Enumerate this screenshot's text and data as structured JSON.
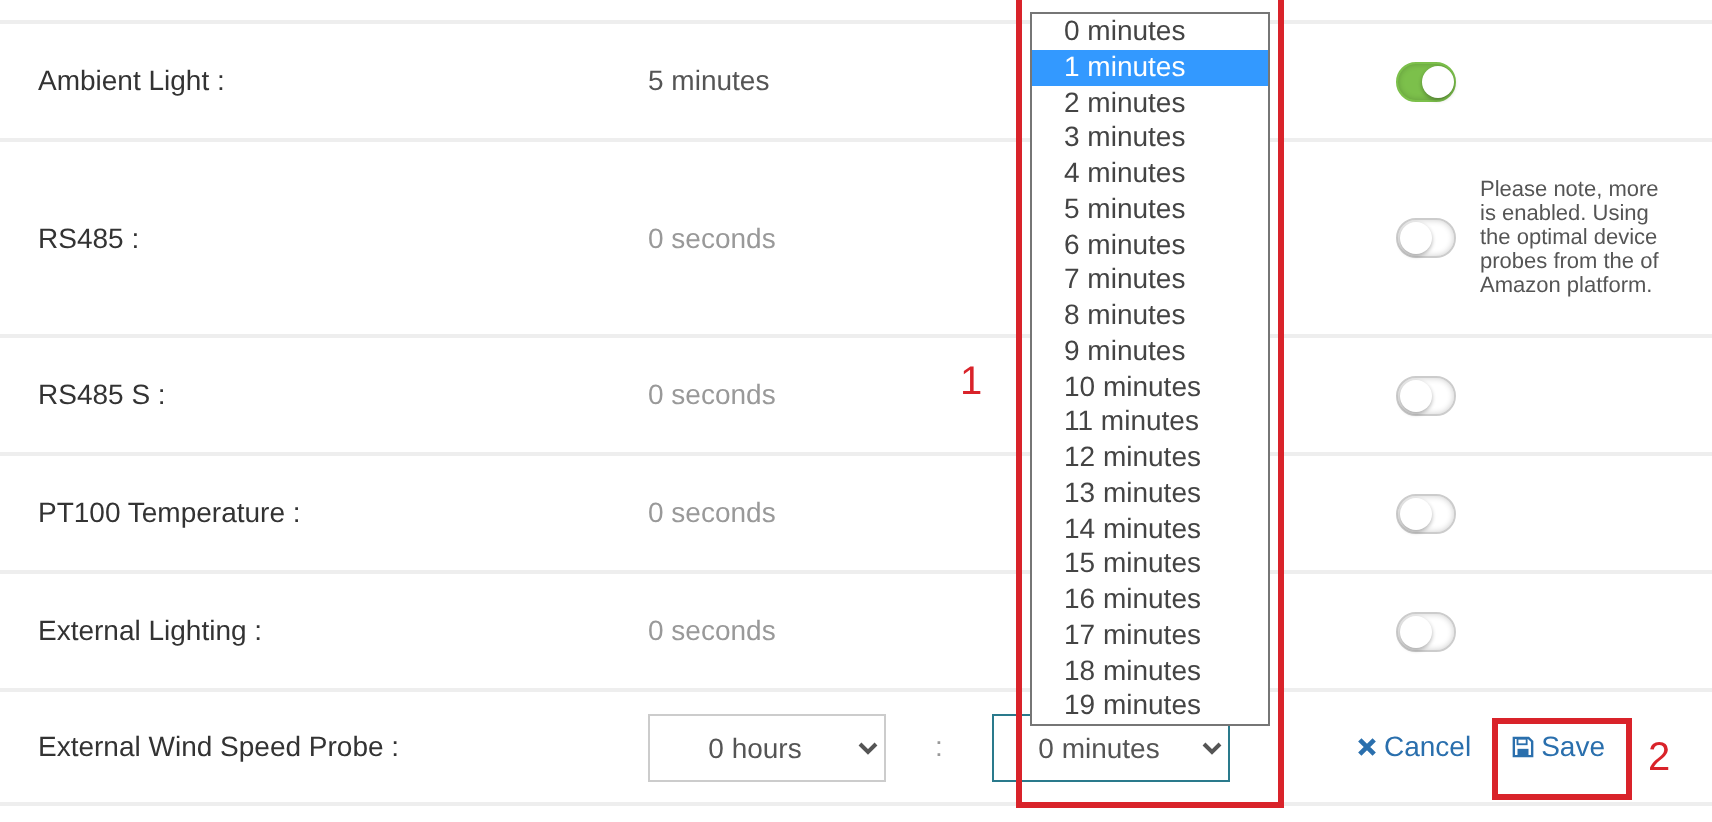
{
  "rows": [
    {
      "label": "Ambient Light :",
      "value": "5 minutes",
      "on": true
    },
    {
      "label": "RS485 :",
      "value": "0 seconds",
      "on": false,
      "note": [
        "Please note, more",
        "is enabled. Using",
        "the optimal device",
        "probes from the of",
        "Amazon platform."
      ]
    },
    {
      "label": "RS485 S :",
      "value": "0 seconds",
      "on": false
    },
    {
      "label": "PT100 Temperature :",
      "value": "0 seconds",
      "on": false
    },
    {
      "label": "External Lighting :",
      "value": "0 seconds",
      "on": false
    }
  ],
  "edit_row": {
    "label": "External Wind Speed Probe :",
    "hours": "0 hours",
    "separator": ":",
    "minutes": "0 minutes",
    "cancel": "Cancel",
    "save": "Save"
  },
  "minutes_list": [
    {
      "label": "0 minutes",
      "selected": false
    },
    {
      "label": "1 minutes",
      "selected": true
    },
    {
      "label": "2 minutes",
      "selected": false
    },
    {
      "label": "3 minutes",
      "selected": false
    },
    {
      "label": "4 minutes",
      "selected": false
    },
    {
      "label": "5 minutes",
      "selected": false
    },
    {
      "label": "6 minutes",
      "selected": false
    },
    {
      "label": "7 minutes",
      "selected": false
    },
    {
      "label": "8 minutes",
      "selected": false
    },
    {
      "label": "9 minutes",
      "selected": false
    },
    {
      "label": "10 minutes",
      "selected": false
    },
    {
      "label": "11 minutes",
      "selected": false
    },
    {
      "label": "12 minutes",
      "selected": false
    },
    {
      "label": "13 minutes",
      "selected": false
    },
    {
      "label": "14 minutes",
      "selected": false
    },
    {
      "label": "15 minutes",
      "selected": false
    },
    {
      "label": "16 minutes",
      "selected": false
    },
    {
      "label": "17 minutes",
      "selected": false
    },
    {
      "label": "18 minutes",
      "selected": false
    },
    {
      "label": "19 minutes",
      "selected": false
    }
  ],
  "markers": [
    "1",
    "2"
  ]
}
